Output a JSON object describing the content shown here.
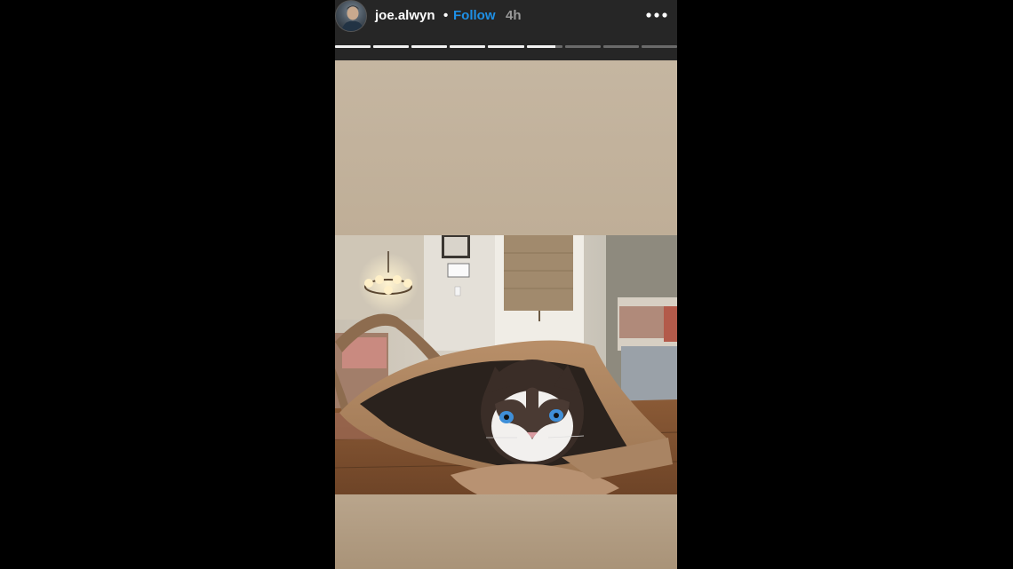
{
  "story": {
    "user": {
      "username": "joe.alwyn",
      "separator": "•",
      "follow_label": "Follow",
      "time_ago": "4h"
    },
    "progress": {
      "segment_count": 9,
      "completed": 5,
      "current_fraction": 0.8
    },
    "colors": {
      "follow": "#1e90e6",
      "header_bg": "#262626",
      "backdrop": "#c3b29c"
    },
    "icons": {
      "more": "more-horizontal-icon"
    },
    "media": {
      "type": "photo"
    }
  }
}
